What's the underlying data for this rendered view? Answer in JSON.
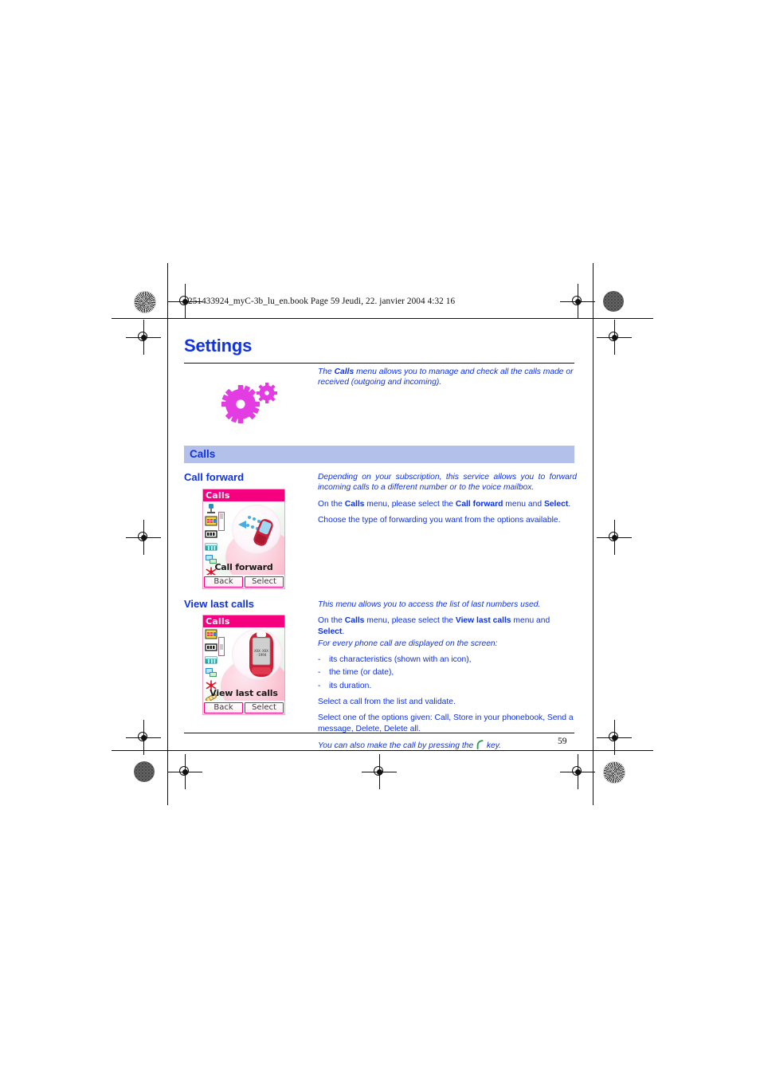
{
  "print_slug": "251433924_myC-3b_lu_en.book  Page 59  Jeudi, 22. janvier 2004  4:32 16",
  "page_title": "Settings",
  "page_number": "59",
  "colors": {
    "heading_blue": "#1032E0",
    "band_blue": "#B3C0EA",
    "phone_header_magenta": "#F5007F",
    "gear_magenta": "#E040E0",
    "call_key_green": "#2EA05A"
  },
  "intro": {
    "before": "The ",
    "bold": "Calls",
    "after": " menu allows you to manage and check all the calls made or received (outgoing and incoming)."
  },
  "section": {
    "band_label": "Calls"
  },
  "call_forward": {
    "heading": "Call forward",
    "para_italic": "Depending on your subscription, this service allows you to forward incoming calls to a different number or to the voice mailbox.",
    "para2": {
      "p1": "On the ",
      "b1": "Calls",
      "p2": " menu, please select the ",
      "b2": "Call forward",
      "p3": " menu and ",
      "b3": "Select",
      "p4": "."
    },
    "para3": "Choose the type of forwarding you want from the options available.",
    "phone": {
      "header": "Calls",
      "label": "Call forward",
      "softkey_left": "Back",
      "softkey_right": "Select",
      "icons": [
        "voicemail-icon",
        "call-forward-icon",
        "call-counters-icon",
        "call-duration-icon",
        "call-cost-icon",
        "hide-id-icon"
      ]
    }
  },
  "view_last_calls": {
    "heading": "View last calls",
    "para_italic": "This menu allows you to access the list of last numbers used.",
    "para2": {
      "p1": "On the ",
      "b1": "Calls",
      "p2": " menu, please select the ",
      "b2": "View last calls",
      "p3": " menu and ",
      "b3": "Select",
      "p4": "."
    },
    "para2_italic": "For every phone call are displayed on the screen:",
    "bullets": [
      "its characteristics (shown with an icon),",
      "the time (or date),",
      "its duration."
    ],
    "bullet_dash": "-",
    "para4": "Select a call from the list and validate.",
    "para5": "Select one of the options given: Call, Store in your phonebook, Send a message, Delete, Delete all.",
    "para6": {
      "before": "You can also make the call by pressing the ",
      "after": " key."
    },
    "phone": {
      "header": "Calls",
      "label": "View last calls",
      "softkey_left": "Back",
      "softkey_right": "Select",
      "screen_number": "XXX-XXX -1994",
      "icons": [
        "call-forward-icon",
        "view-last-calls-icon",
        "call-duration-icon",
        "call-cost-icon",
        "hide-id-icon",
        "call-waiting-icon"
      ]
    }
  }
}
